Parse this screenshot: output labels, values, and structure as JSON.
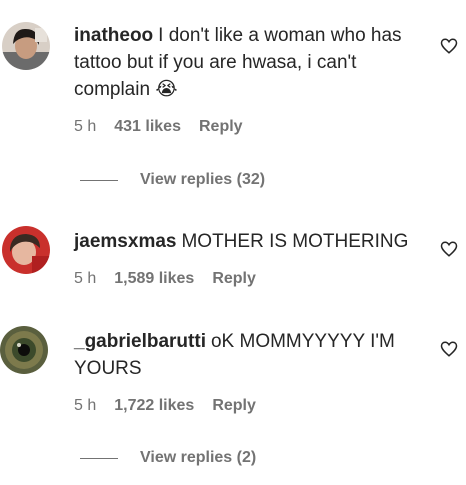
{
  "comments": [
    {
      "username": "inatheoo",
      "text": "I don't like a woman who has tattoo but if you are hwasa, i can't complain",
      "emoji": "😭",
      "time": "5 h",
      "likes": "431 likes",
      "reply": "Reply",
      "view_replies": "View replies (32)"
    },
    {
      "username": "jaemsxmas",
      "text": "MOTHER IS MOTHERING",
      "time": "5 h",
      "likes": "1,589 likes",
      "reply": "Reply"
    },
    {
      "username": "_gabrielbarutti",
      "text": "oK MOMMYYYYY I'M YOURS",
      "time": "5 h",
      "likes": "1,722 likes",
      "reply": "Reply",
      "view_replies": "View replies (2)"
    }
  ],
  "icons": {
    "like": "heart-outline-icon"
  },
  "colors": {
    "text": "#262626",
    "secondary": "#737373"
  }
}
